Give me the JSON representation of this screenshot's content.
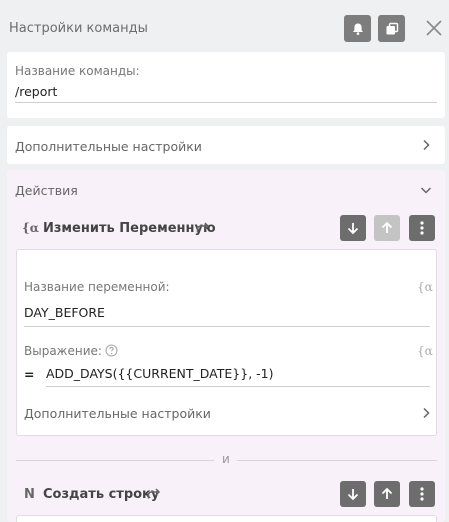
{
  "header": {
    "title": "Настройки команды"
  },
  "command": {
    "name_label": "Название команды:",
    "name_value": "/report"
  },
  "extra_settings": {
    "label": "Дополнительные настройки"
  },
  "actions": {
    "label": "Действия",
    "action1": {
      "prefix": "{α",
      "title": "Изменить Переменную",
      "var_label": "Название переменной:",
      "var_value": "DAY_BEFORE",
      "expr_label": "Выражение:",
      "expr_eq": "=",
      "expr_value": "ADD_DAYS({{CURRENT_DATE}}, -1)",
      "extra_label": "Дополнительные настройки",
      "alpha_mark": "{α"
    },
    "separator": "и",
    "action2": {
      "prefix": "N",
      "title": "Создать строку"
    }
  },
  "colors": {
    "button_bg": "#6d6d6d",
    "button_disabled": "#c4c4c4",
    "actions_bg": "#f8f1f9"
  },
  "icons": [
    "bell-icon",
    "copy-icon",
    "close-icon",
    "chevron-right-icon",
    "chevron-down-icon",
    "arrow-down-icon",
    "arrow-up-icon",
    "kebab-menu-icon",
    "redo-icon",
    "help-icon"
  ]
}
